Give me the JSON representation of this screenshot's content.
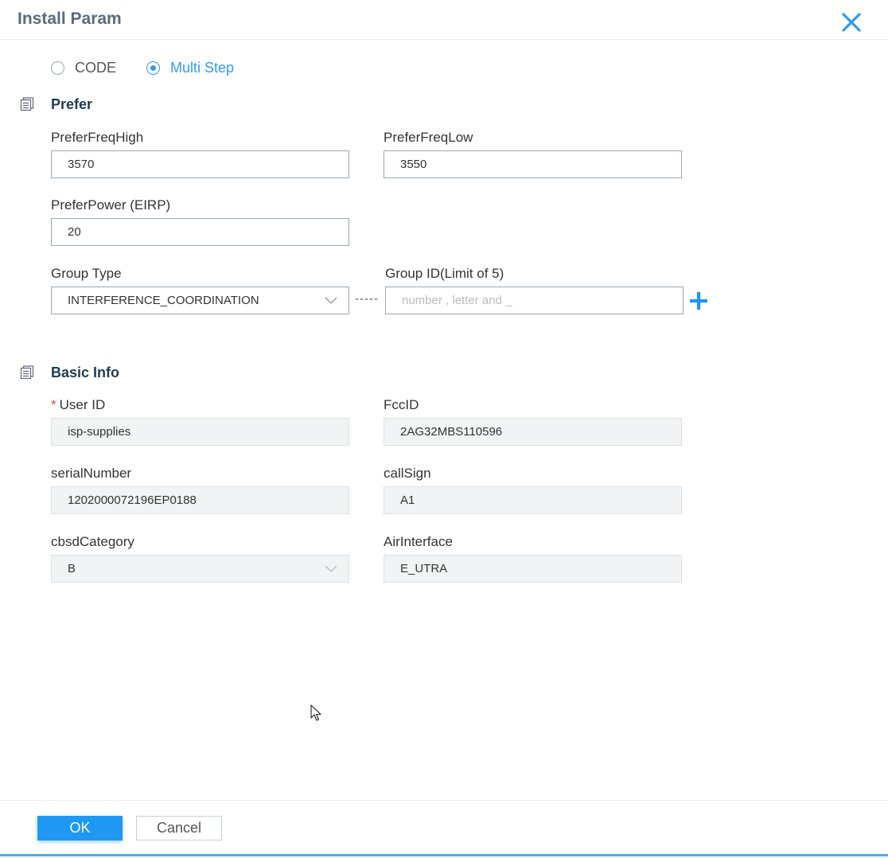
{
  "dialog": {
    "title": "Install Param"
  },
  "mode": {
    "options": [
      {
        "label": "CODE",
        "checked": false
      },
      {
        "label": "Multi Step",
        "checked": true
      }
    ]
  },
  "prefer": {
    "title": "Prefer",
    "freq_high": {
      "label": "PreferFreqHigh",
      "value": "3570"
    },
    "freq_low": {
      "label": "PreferFreqLow",
      "value": "3550"
    },
    "power": {
      "label": "PreferPower (EIRP)",
      "value": "20"
    },
    "group_type": {
      "label": "Group Type",
      "value": "INTERFERENCE_COORDINATION"
    },
    "group_id": {
      "label": "Group ID(Limit of 5)",
      "placeholder": "number , letter and _"
    },
    "separator": "-----"
  },
  "basic": {
    "title": "Basic Info",
    "user_id": {
      "required_mark": "*",
      "label": "User ID",
      "value": "isp-supplies"
    },
    "fcc_id": {
      "label": "FccID",
      "value": "2AG32MBS110596"
    },
    "serial_number": {
      "label": "serialNumber",
      "value": "1202000072196EP0188"
    },
    "call_sign": {
      "label": "callSign",
      "value": "A1"
    },
    "cbsd_category": {
      "label": "cbsdCategory",
      "value": "B"
    },
    "air_interface": {
      "label": "AirInterface",
      "value": "E_UTRA"
    }
  },
  "footer": {
    "ok_label": "OK",
    "cancel_label": "Cancel"
  },
  "colors": {
    "accent": "#2d9cf0",
    "primary_button": "#1e98f2",
    "section_title": "#1f3a55",
    "required": "#e0413a"
  },
  "icons": {
    "close": "close-icon",
    "section": "document-list-icon",
    "dropdown": "chevron-down-icon",
    "add": "plus-icon",
    "pointer": "mouse-pointer-icon"
  }
}
